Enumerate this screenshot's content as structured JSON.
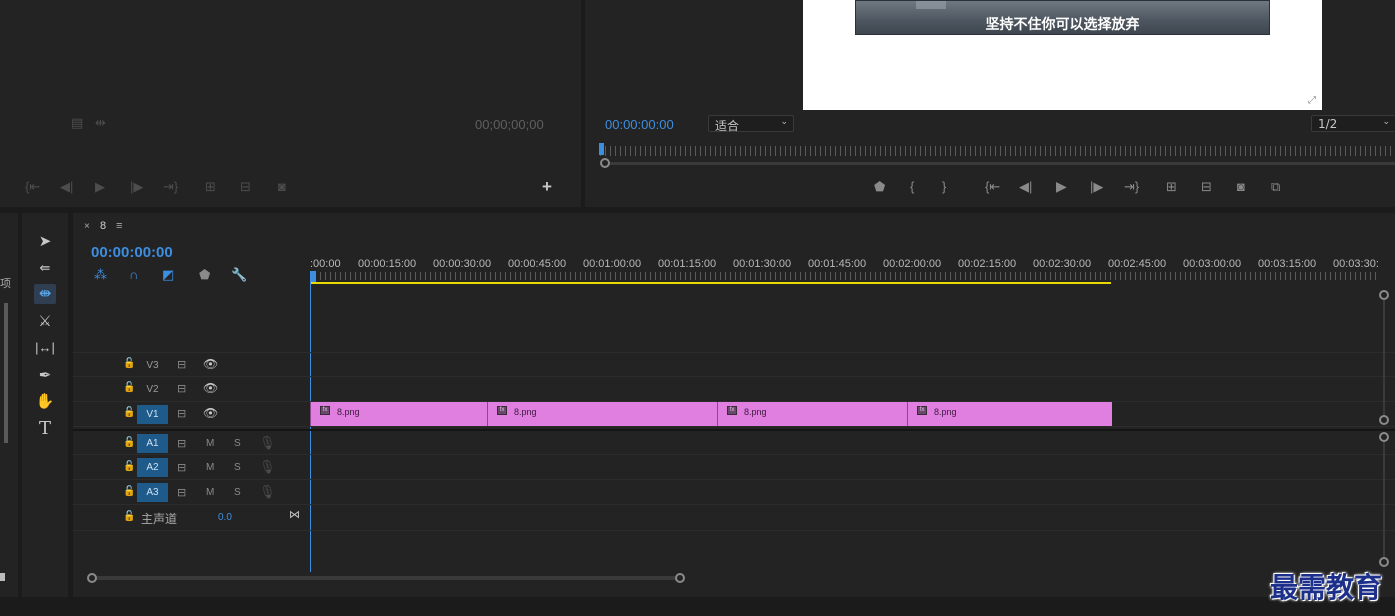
{
  "source": {
    "timecode": "00;00;00;00",
    "add_label": "+"
  },
  "program": {
    "timecode": "00:00:00:00",
    "fit_value": "适合",
    "resolution_value": "1/2",
    "caption": "坚持不住你可以选择放弃"
  },
  "timeline": {
    "tab_close": "×",
    "sequence_name": "8",
    "menu_label": "≡",
    "timecode": "00:00:00:00",
    "ruler_labels": [
      ":00:00",
      "00:00:15:00",
      "00:00:30:00",
      "00:00:45:00",
      "00:01:00:00",
      "00:01:15:00",
      "00:01:30:00",
      "00:01:45:00",
      "00:02:00:00",
      "00:02:15:00",
      "00:02:30:00",
      "00:02:45:00",
      "00:03:00:00",
      "00:03:15:00",
      "00:03:30:"
    ],
    "video_tracks": [
      "V3",
      "V2",
      "V1"
    ],
    "audio_tracks": [
      "A1",
      "A2",
      "A3"
    ],
    "mute_label": "M",
    "solo_label": "S",
    "master_label": "主声道",
    "master_value": "0.0",
    "clips": [
      {
        "name": "8.png"
      },
      {
        "name": "8.png"
      },
      {
        "name": "8.png"
      },
      {
        "name": "8.png"
      }
    ],
    "left_edge_char": "项"
  },
  "watermark": "最需教育",
  "colors": {
    "accent_blue": "#3d8ee0",
    "clip_pink": "#e07fe0",
    "work_area_yellow": "#e6d800",
    "track_on": "#1e5a8a"
  }
}
